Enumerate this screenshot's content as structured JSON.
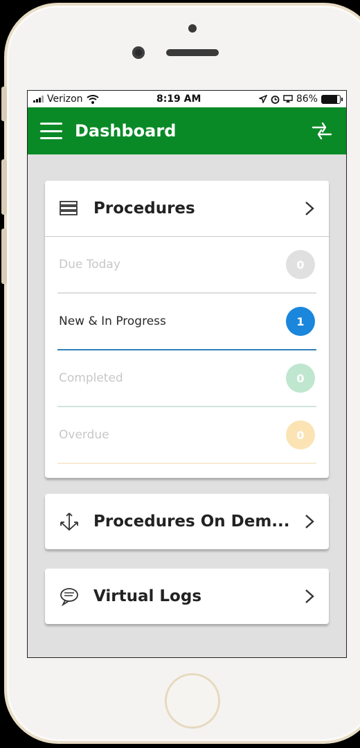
{
  "status_bar": {
    "carrier": "Verizon",
    "time": "8:19 AM",
    "battery": "86%",
    "battery_level": 0.86
  },
  "nav": {
    "title": "Dashboard",
    "menu_icon": "hamburger-menu-icon",
    "action_icon": "swap-arrows-icon"
  },
  "procedures_card": {
    "title": "Procedures",
    "icon": "stacked-list-icon",
    "rows": [
      {
        "label": "Due Today",
        "count": "0",
        "label_color": "#c7c7c7",
        "badge_color": "#e0e0e0",
        "line_color": "#dcdcdc"
      },
      {
        "label": "New & In Progress",
        "count": "1",
        "label_color": "#2a2a2a",
        "badge_color": "#1a86dc",
        "line_color": "#2f7fb8"
      },
      {
        "label": "Completed",
        "count": "0",
        "label_color": "#c7c7c7",
        "badge_color": "#bfe6cf",
        "line_color": "#cfe4dc"
      },
      {
        "label": "Overdue",
        "count": "0",
        "label_color": "#c7c7c7",
        "badge_color": "#fbe3b4",
        "line_color": "#f7ecd2"
      }
    ]
  },
  "on_demand_card": {
    "title": "Procedures On Dem...",
    "icon": "anchor-arrows-icon"
  },
  "virtual_logs_card": {
    "title": "Virtual Logs",
    "icon": "chat-bubble-icon"
  },
  "colors": {
    "brand_green": "#0a8a27",
    "accent_blue": "#1a86dc"
  }
}
